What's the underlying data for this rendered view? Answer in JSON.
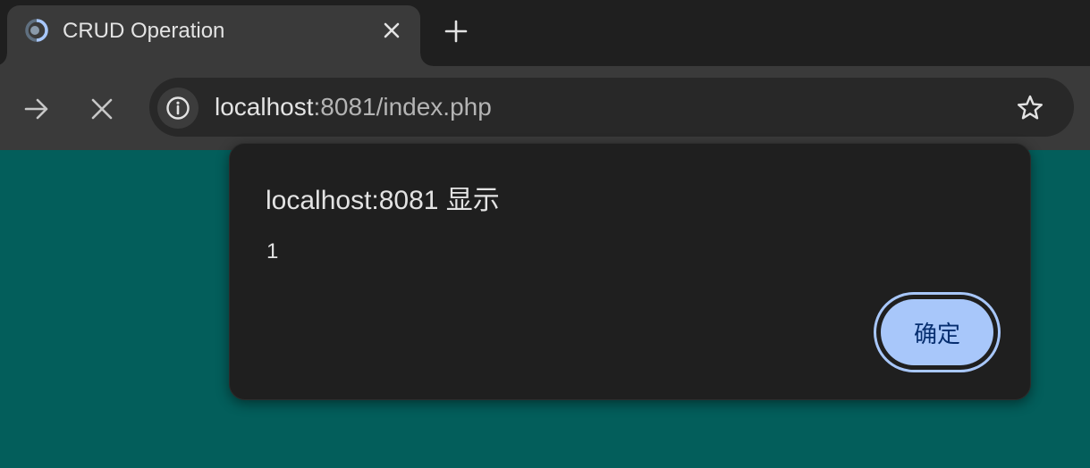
{
  "browser": {
    "tab": {
      "title": "CRUD Operation",
      "favicon": "loading-spinner-icon"
    },
    "icons": {
      "close_tab": "close-icon",
      "new_tab": "plus-icon",
      "forward": "arrow-right-icon",
      "stop": "close-icon",
      "site_info": "info-icon",
      "bookmark": "star-icon"
    },
    "address_bar": {
      "host": "localhost",
      "rest": ":8081/index.php"
    }
  },
  "dialog": {
    "title": "localhost:8081 显示",
    "message": "1",
    "ok_label": "确定"
  },
  "colors": {
    "page_background": "#035e5b",
    "accent": "#a8c7fa",
    "dialog_background": "#1f1f1f"
  }
}
